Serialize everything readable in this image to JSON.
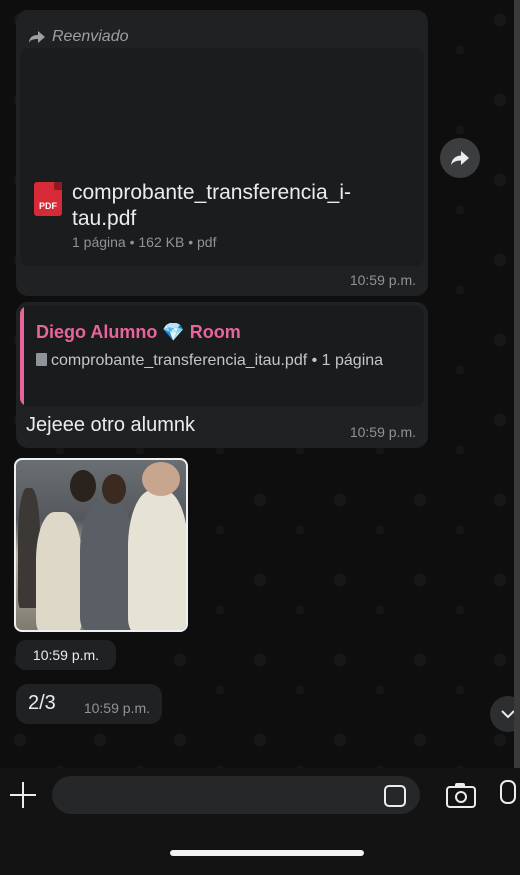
{
  "messages": {
    "forwarded": {
      "label": "Reenviado",
      "doc_name": "comprobante_transferencia_i-tau.pdf",
      "doc_meta": "1 página • 162 KB • pdf",
      "pdf_badge": "PDF",
      "time": "10:59 p.m."
    },
    "reply": {
      "quoted_name": "Diego Alumno 💎 Room",
      "quoted_doc": "comprobante_transferencia_itau.pdf • 1 página",
      "text": "Jejeee otro alumnk",
      "time": "10:59 p.m."
    },
    "photo": {
      "time": "10:59 p.m."
    },
    "short": {
      "text": "2/3",
      "time": "10:59 p.m."
    }
  },
  "colors": {
    "accent_quote": "#e8659b",
    "pdf_red": "#d62a36"
  },
  "icons": [
    "forward-icon",
    "share-icon",
    "pdf-icon",
    "doc-icon",
    "plus-icon",
    "sticker-icon",
    "camera-icon",
    "mic-icon",
    "chevron-down-icon"
  ]
}
